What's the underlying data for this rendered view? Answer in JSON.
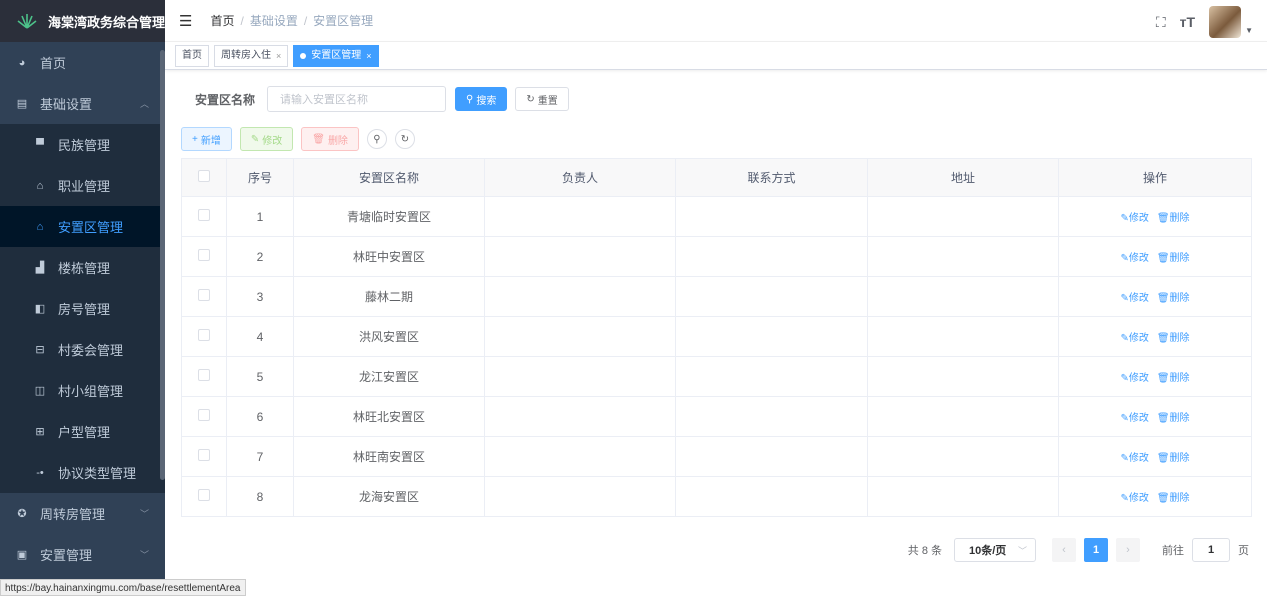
{
  "app": {
    "title": "海棠湾政务综合管理"
  },
  "sidebar": {
    "items": [
      {
        "label": "首页",
        "icon": "dashboard-icon"
      },
      {
        "label": "基础设置",
        "icon": "grid-icon",
        "expanded": true
      },
      {
        "label": "周转房管理",
        "icon": "cycle-icon"
      },
      {
        "label": "安置管理",
        "icon": "box-icon"
      }
    ],
    "sub_items": [
      {
        "label": "民族管理",
        "icon": "monitor-icon"
      },
      {
        "label": "职业管理",
        "icon": "tag-icon"
      },
      {
        "label": "安置区管理",
        "icon": "tag-icon",
        "active": true
      },
      {
        "label": "楼栋管理",
        "icon": "chart-icon"
      },
      {
        "label": "房号管理",
        "icon": "copy-icon"
      },
      {
        "label": "村委会管理",
        "icon": "briefcase-icon"
      },
      {
        "label": "村小组管理",
        "icon": "table-icon"
      },
      {
        "label": "户型管理",
        "icon": "list-icon"
      },
      {
        "label": "协议类型管理",
        "icon": "minus-icon"
      }
    ]
  },
  "breadcrumb": {
    "items": [
      "首页",
      "基础设置",
      "安置区管理"
    ]
  },
  "tags": [
    {
      "label": "首页",
      "closable": false,
      "active": false
    },
    {
      "label": "周转房入住",
      "closable": true,
      "active": false
    },
    {
      "label": "安置区管理",
      "closable": true,
      "active": true
    }
  ],
  "search": {
    "label": "安置区名称",
    "placeholder": "请输入安置区名称",
    "search_btn": "搜索",
    "reset_btn": "重置"
  },
  "toolbar": {
    "add": "新增",
    "edit": "修改",
    "delete": "删除"
  },
  "table": {
    "columns": [
      "序号",
      "安置区名称",
      "负责人",
      "联系方式",
      "地址",
      "操作"
    ],
    "rows": [
      {
        "no": "1",
        "name": "青塘临时安置区"
      },
      {
        "no": "2",
        "name": "林旺中安置区"
      },
      {
        "no": "3",
        "name": "藤林二期"
      },
      {
        "no": "4",
        "name": "洪风安置区"
      },
      {
        "no": "5",
        "name": "龙江安置区"
      },
      {
        "no": "6",
        "name": "林旺北安置区"
      },
      {
        "no": "7",
        "name": "林旺南安置区"
      },
      {
        "no": "8",
        "name": "龙海安置区"
      }
    ],
    "row_edit": "修改",
    "row_delete": "删除"
  },
  "pagination": {
    "total": "共 8 条",
    "page_size": "10条/页",
    "current_page": "1",
    "goto_prefix": "前往",
    "goto_value": "1",
    "goto_suffix": "页"
  },
  "status_url": "https://bay.hainanxingmu.com/base/resettlementArea",
  "colors": {
    "primary": "#409eff",
    "sidebar_bg": "#304156",
    "submenu_bg": "#1f2d3d",
    "active_bg": "#001528"
  }
}
